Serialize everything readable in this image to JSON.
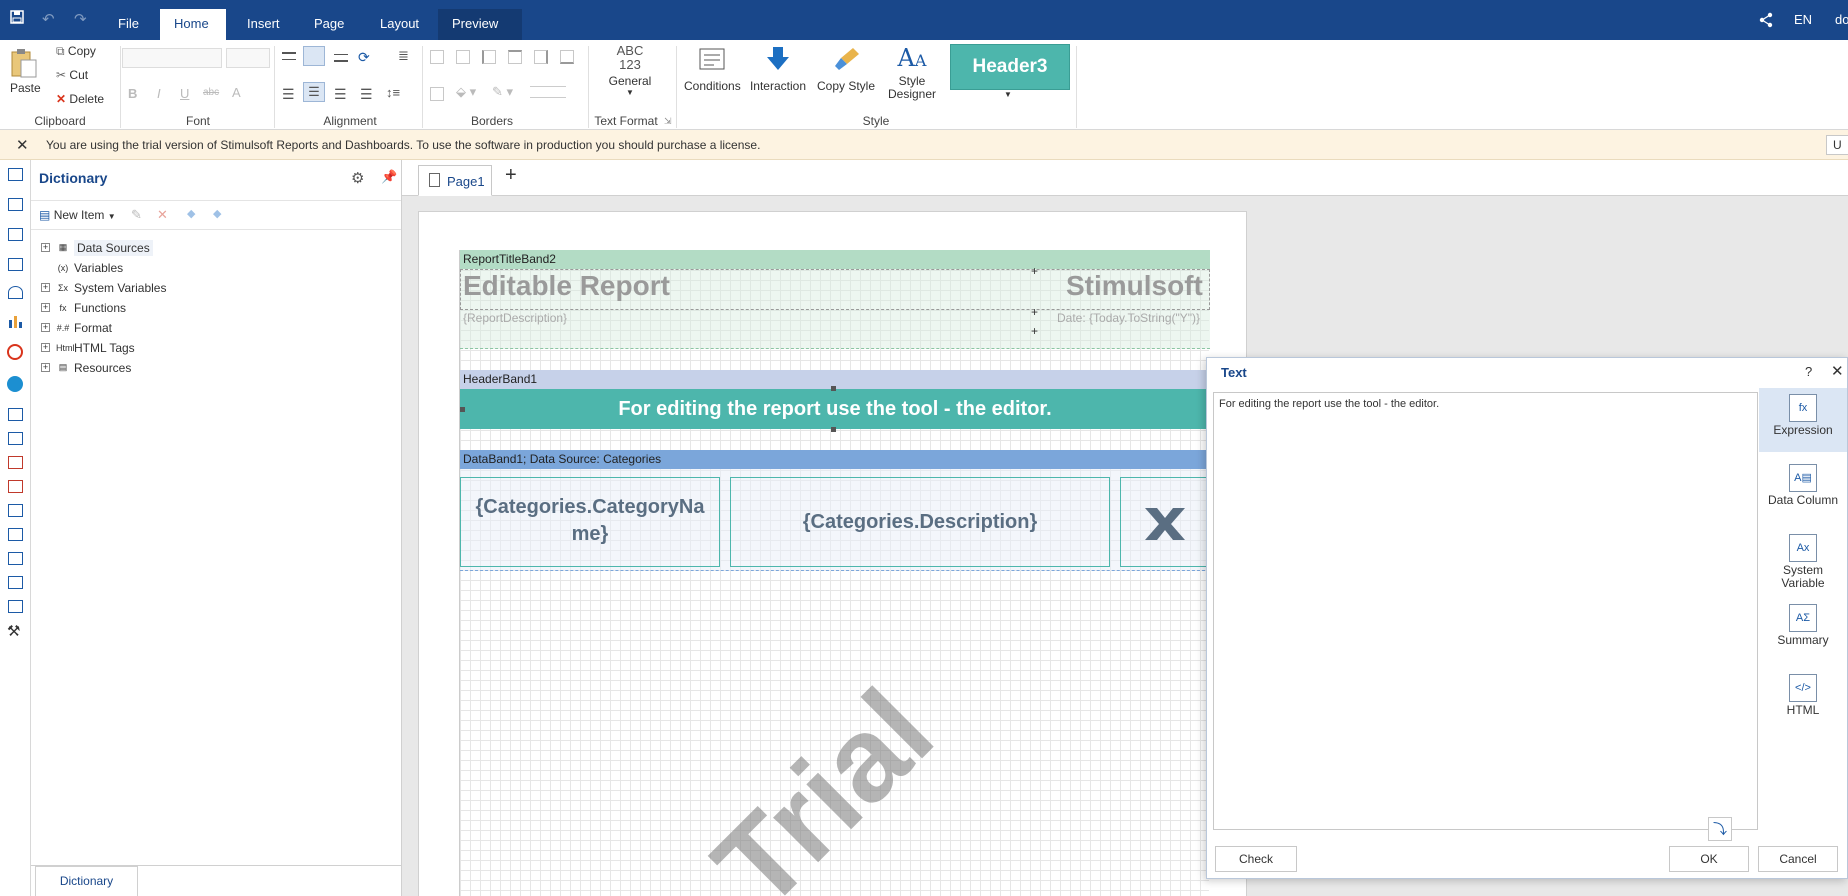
{
  "menu": {
    "tabs": [
      "File",
      "Home",
      "Insert",
      "Page",
      "Layout",
      "Preview"
    ],
    "active_tab": "Home",
    "language": "EN",
    "user_initials": "do"
  },
  "ribbon": {
    "clipboard": {
      "paste": "Paste",
      "copy": "Copy",
      "cut": "Cut",
      "delete": "Delete",
      "label": "Clipboard"
    },
    "font": {
      "label": "Font",
      "bold": "B",
      "italic": "I",
      "underline": "U",
      "strike": "abc",
      "color": "A"
    },
    "alignment": {
      "label": "Alignment"
    },
    "borders": {
      "label": "Borders"
    },
    "text_format": {
      "line1": "ABC",
      "line2": "123",
      "general": "General",
      "label": "Text Format"
    },
    "style": {
      "conditions": "Conditions",
      "interaction": "Interaction",
      "copy_style": "Copy Style",
      "style_designer_line1": "Style",
      "style_designer_line2": "Designer",
      "preset": "Header3",
      "label": "Style"
    }
  },
  "trial_message": "You are using the trial version of Stimulsoft Reports and Dashboards. To use the software in production you should purchase a license.",
  "trial_button_partial": "U",
  "dictionary": {
    "title": "Dictionary",
    "new_item": "New Item",
    "tree": [
      {
        "label": "Data Sources",
        "icon": "table-icon",
        "icon_text": "▦",
        "expandable": true
      },
      {
        "label": "Variables",
        "icon": "variables-icon",
        "icon_text": "(x)",
        "expandable": false
      },
      {
        "label": "System Variables",
        "icon": "system-variables-icon",
        "icon_text": "Σx",
        "expandable": true
      },
      {
        "label": "Functions",
        "icon": "function-icon",
        "icon_text": "fx",
        "expandable": true
      },
      {
        "label": "Format",
        "icon": "format-icon",
        "icon_text": "#.#",
        "expandable": true
      },
      {
        "label": "HTML Tags",
        "icon": "html-icon",
        "icon_text": "Html",
        "expandable": true
      },
      {
        "label": "Resources",
        "icon": "resources-icon",
        "icon_text": "▤",
        "expandable": true
      }
    ],
    "bottom_tab": "Dictionary"
  },
  "designer": {
    "page_tab": "Page1",
    "bands": {
      "report_title": "ReportTitleBand2",
      "header": "HeaderBand1",
      "data": "DataBand1; Data Source: Categories"
    },
    "report_title_text": "Editable Report",
    "brand_text": "Stimulsoft",
    "report_description": "{ReportDescription}",
    "date_expression": "Date: {Today.ToString(\"Y\")}",
    "header_text": "For editing the report use the tool - the editor.",
    "cells": {
      "category_name_line1": "{Categories.CategoryNa",
      "category_name_line2": "me}",
      "description": "{Categories.Description}"
    },
    "watermark": "Trial",
    "colors": {
      "report_title_band": "#b3dcc5",
      "header_band": "#c6d1e9",
      "header_fill": "#4db6ac",
      "data_band": "#7ba6da",
      "preset_style": "#4db6ac",
      "menu_bar": "#19478a"
    }
  },
  "text_dialog": {
    "title": "Text",
    "help": "?",
    "content": "For editing the report use the tool - the editor.",
    "options": [
      {
        "label_line1": "Expression",
        "label_line2": "",
        "icon": "expression-icon",
        "icon_text": "fx",
        "selected": true
      },
      {
        "label_line1": "Data Column",
        "label_line2": "",
        "icon": "data-column-icon",
        "icon_text": "A▤",
        "selected": false
      },
      {
        "label_line1": "System",
        "label_line2": "Variable",
        "icon": "system-variable-icon",
        "icon_text": "Ax",
        "selected": false
      },
      {
        "label_line1": "Summary",
        "label_line2": "",
        "icon": "summary-icon",
        "icon_text": "AΣ",
        "selected": false
      },
      {
        "label_line1": "HTML",
        "label_line2": "",
        "icon": "html-tag-icon",
        "icon_text": "</>",
        "selected": false
      }
    ],
    "check": "Check",
    "ok": "OK",
    "cancel": "Cancel"
  }
}
